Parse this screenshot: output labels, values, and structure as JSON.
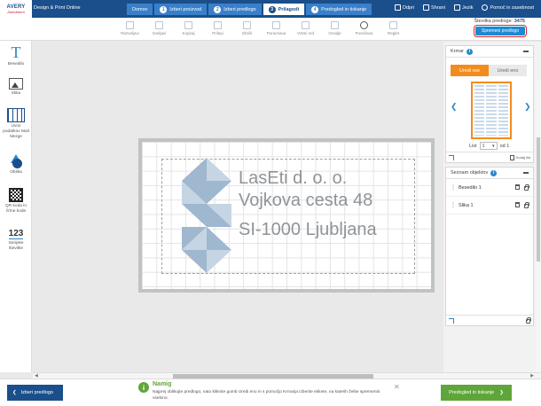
{
  "header": {
    "logo_main": "AVERY",
    "logo_sub": "Zweckform",
    "app_title": "Design & Print Online",
    "steps": [
      {
        "label": "Domov",
        "num": ""
      },
      {
        "label": "Izberi proizvod",
        "num": "1"
      },
      {
        "label": "Izberi predlogo",
        "num": "2"
      },
      {
        "label": "Prilagodi",
        "num": "3"
      },
      {
        "label": "Predogled in tiskanje",
        "num": "4"
      }
    ],
    "right_links": [
      "Odpri",
      "Shrani",
      "Jezik",
      "Pomoč in zasebnost"
    ]
  },
  "toolbar": {
    "tools": [
      "Razveljavi",
      "Sveljavi",
      "Kopiraj",
      "Prilepi",
      "Izbriši",
      "Poravnava",
      "Vrstni red",
      "Ozadje",
      "Povečava",
      "Reglet"
    ],
    "stevilka_label": "Številka predloge:",
    "stevilka_value": "3475",
    "save_label": "Spremeni predlogo"
  },
  "sidebar": {
    "items": [
      {
        "label": "Besedilo",
        "icon": "text-icon"
      },
      {
        "label": "Slika",
        "icon": "image-icon"
      },
      {
        "label": "Uvoz podatkov Mail Merge",
        "icon": "spreadsheet-icon"
      },
      {
        "label": "Oblika",
        "icon": "shape-icon"
      },
      {
        "label": "QR koda in črtne kode",
        "icon": "qr-code-icon"
      },
      {
        "label": "Serijske številke",
        "icon": "numbering-icon"
      }
    ]
  },
  "canvas": {
    "line1": "LasEti d. o. o.",
    "line2": "Vojkova cesta 48",
    "line3": "SI-1000 Ljubljana",
    "shape_color": "#9fb7cf"
  },
  "krmar": {
    "title": "Krmar",
    "tab_all": "Uredi vse",
    "tab_one": "Uredi eno",
    "list_label": "List",
    "page_value": "1",
    "of_label": "od 1",
    "add_page": "Dodaj list"
  },
  "objects": {
    "title": "Seznam objektov",
    "items": [
      "Besedilo 1",
      "Slika 1"
    ]
  },
  "footer": {
    "back_label": "Izberi predlogo",
    "next_label": "Predogled in tiskanje",
    "tip_title": "Namig",
    "tip_text": "Najprej oblikujte predlogo, nato kliknite gumb Uredi eno in s pomočjo Krmarja izberite etikete, na katerih želite spremeniti vsebino."
  },
  "colors": {
    "brand": "#1a4f8b",
    "accent_orange": "#f28c1e",
    "action_green": "#5fa63a",
    "highlight_red": "#d9262b"
  }
}
